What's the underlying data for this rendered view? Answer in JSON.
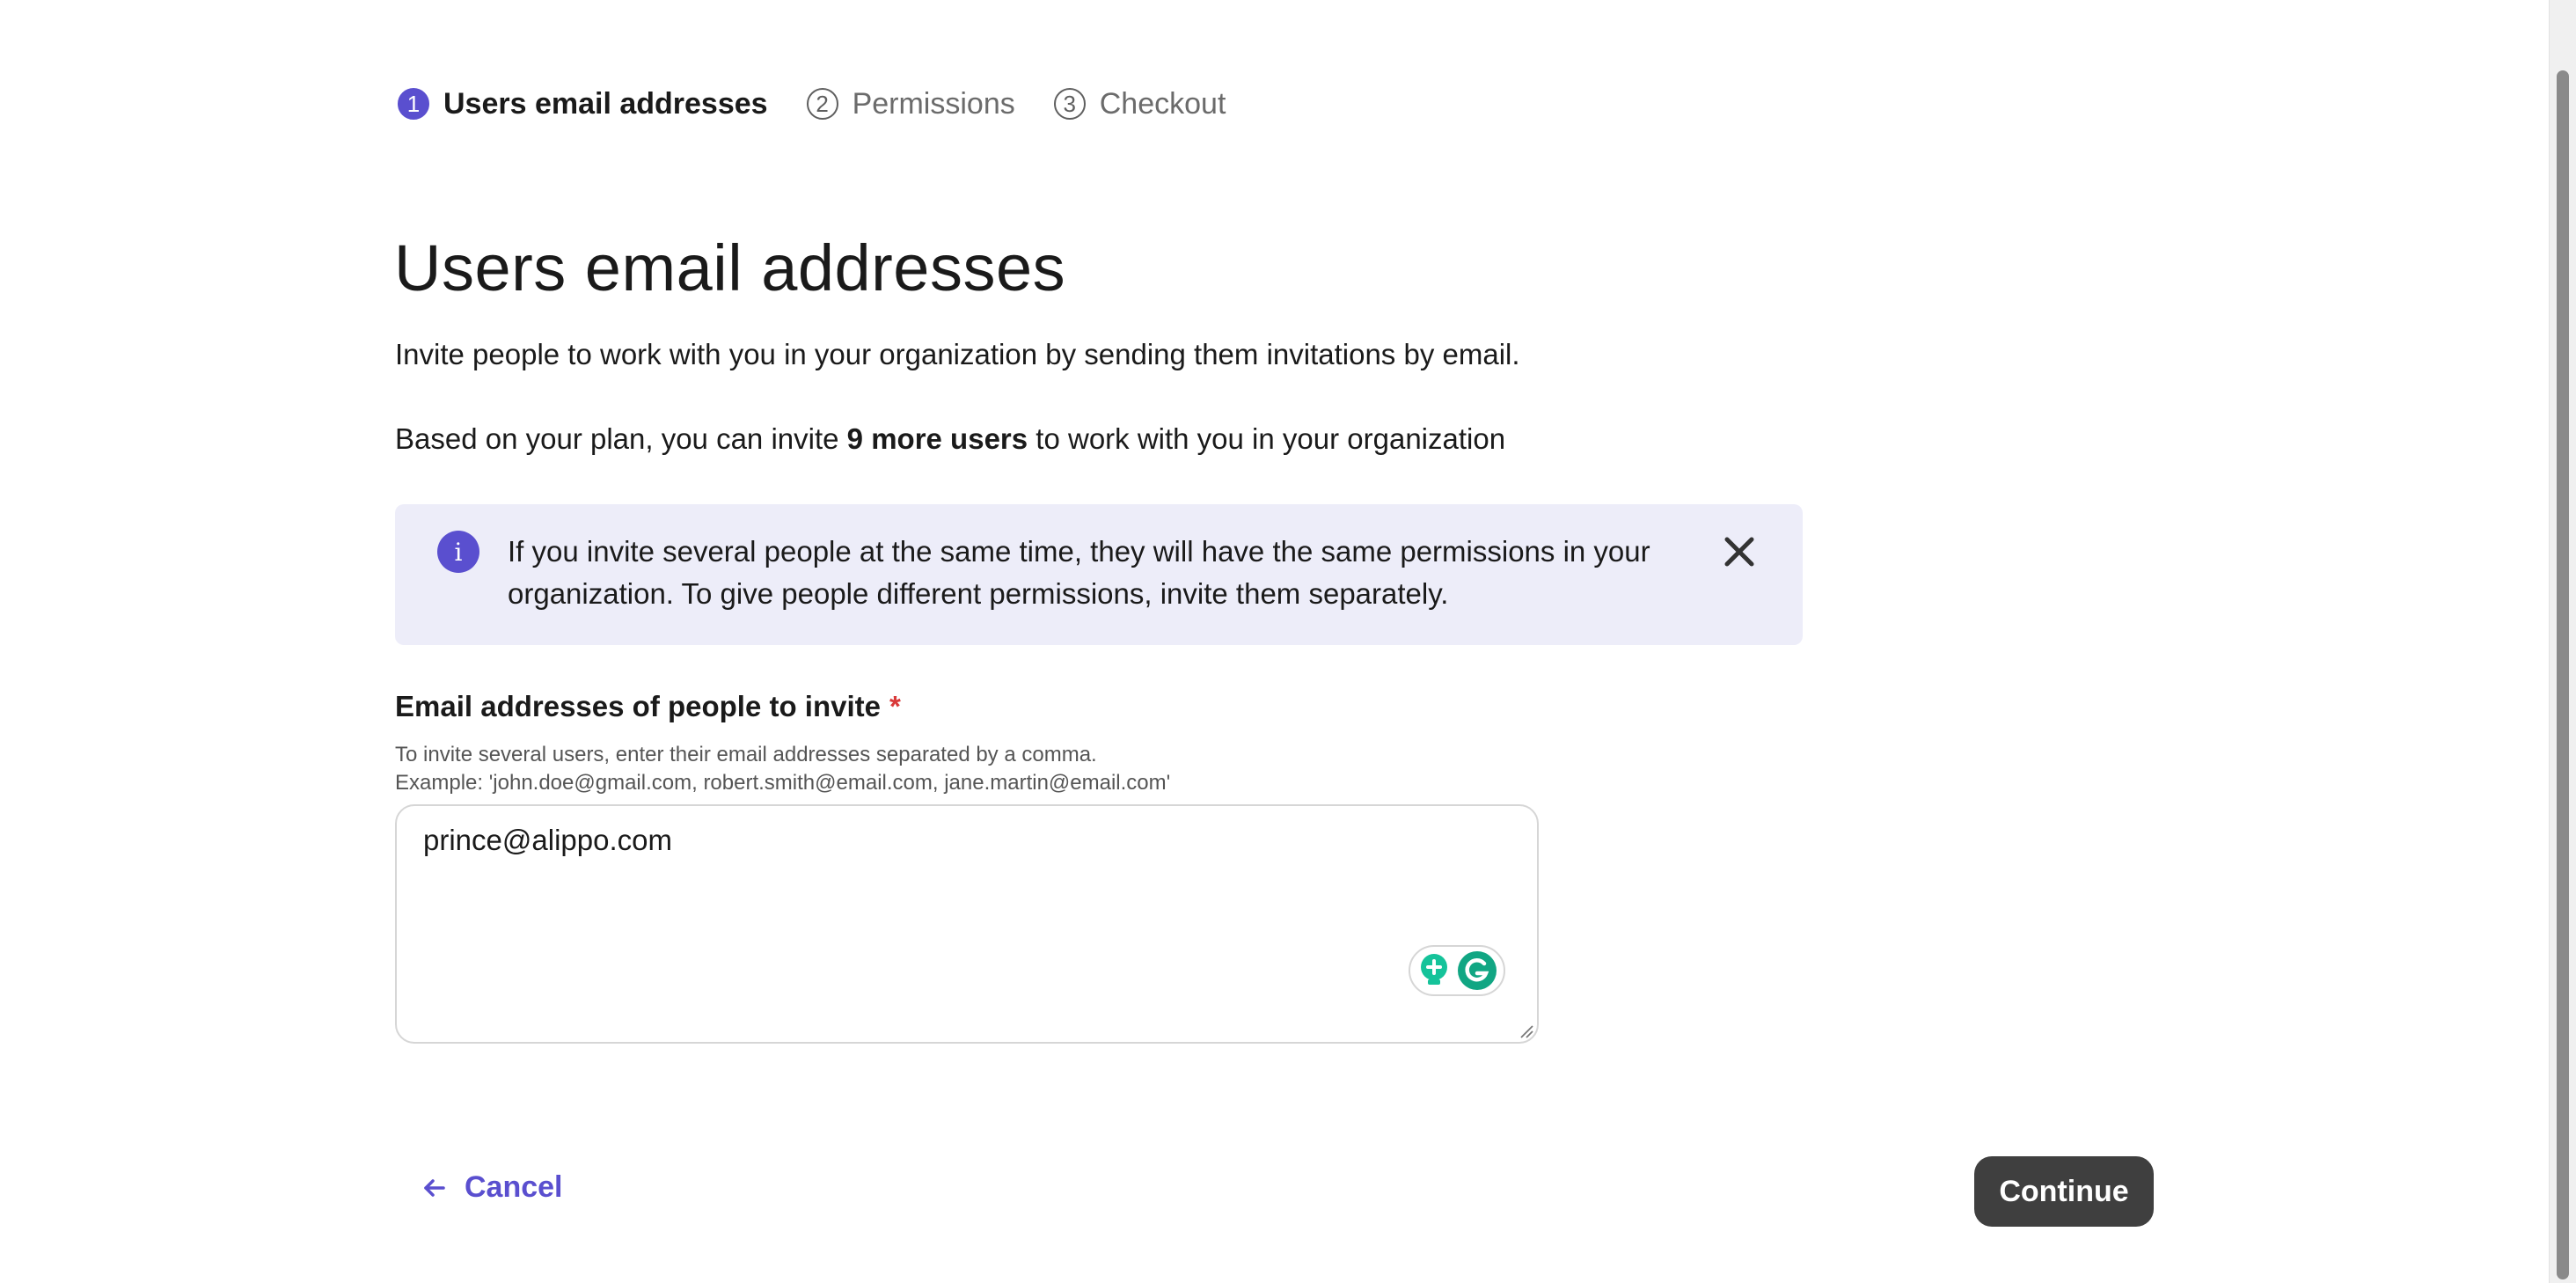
{
  "stepper": {
    "steps": [
      {
        "number": "1",
        "label": "Users email addresses",
        "state": "active"
      },
      {
        "number": "2",
        "label": "Permissions",
        "state": "inactive"
      },
      {
        "number": "3",
        "label": "Checkout",
        "state": "inactive"
      }
    ]
  },
  "main": {
    "title": "Users email addresses",
    "intro": "Invite people to work with you in your organization by sending them invitations by email.",
    "plan_prefix": "Based on your plan, you can invite ",
    "plan_bold": "9 more users",
    "plan_suffix": " to work with you in your organization"
  },
  "banner": {
    "icon": "info-icon",
    "icon_glyph": "i",
    "text": "If you invite several people at the same time, they will have the same permissions in your organization. To give people different permissions, invite them separately.",
    "close_icon": "close-icon"
  },
  "email_field": {
    "label": "Email addresses of people to invite",
    "required_mark": "*",
    "help_line1": "To invite several users, enter their email addresses separated by a comma.",
    "help_line2": "Example: 'john.doe@gmail.com, robert.smith@email.com, jane.martin@email.com'",
    "value": "prince@alippo.com"
  },
  "actions": {
    "cancel_label": "Cancel",
    "continue_label": "Continue"
  },
  "colors": {
    "accent": "#5a4fcf",
    "banner_bg": "#ededf9",
    "required": "#d93a3a",
    "continue_bg": "#3f3f3f",
    "grammarly_green": "#15c39a"
  }
}
